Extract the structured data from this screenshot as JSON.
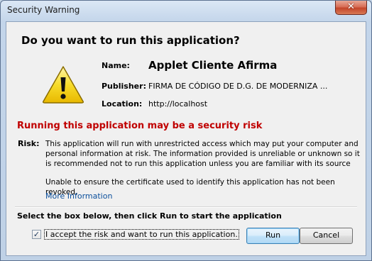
{
  "window": {
    "title": "Security Warning",
    "close_glyph": "✕"
  },
  "dialog": {
    "heading": "Do you want to run this application?",
    "warning_icon": "warning-triangle-icon",
    "name_label": "Name:",
    "name_value": "Applet Cliente Afirma",
    "publisher_label": "Publisher:",
    "publisher_value": "FIRMA DE CÓDIGO DE D.G. DE MODERNIZA ...",
    "location_label": "Location:",
    "location_value": "http://localhost",
    "risk_title": "Running this application may be a security risk",
    "risk_label": "Risk:",
    "risk_text": "This application will run with unrestricted access which may put your computer and personal information at risk. The information provided is unreliable or unknown so it is recommended not to run this application unless you are familiar with its source",
    "cert_text": "Unable to ensure the certificate used to identify this application has not been revoked.",
    "more_info": "More Information",
    "instruction": "Select the box below, then click Run to start the application",
    "checkbox_label": "I accept the risk and want to run this application.",
    "checkbox_checked": true,
    "checkmark": "✓",
    "run_label": "Run",
    "cancel_label": "Cancel"
  },
  "colors": {
    "risk_red": "#c00000",
    "link_blue": "#0b4f9c",
    "warning_yellow": "#f5d000"
  }
}
